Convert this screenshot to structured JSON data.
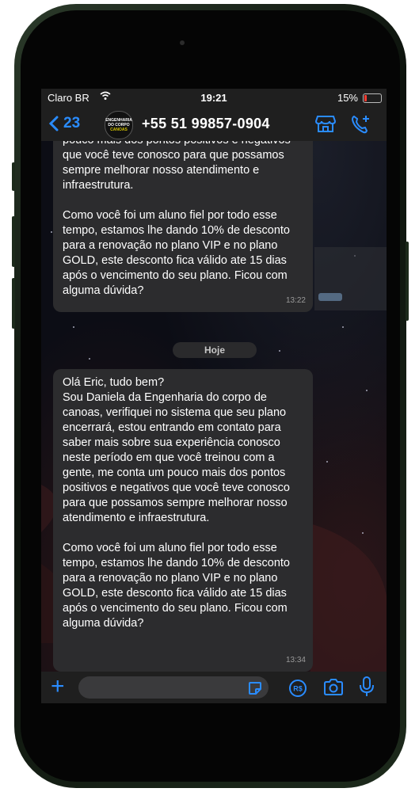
{
  "status_bar": {
    "carrier": "Claro BR",
    "time": "19:21",
    "battery": "15%",
    "battery_level": 0.15
  },
  "header": {
    "back_count": "23",
    "avatar_text": [
      "ENGENHARIA",
      "DO CORPO",
      "CANOAS"
    ],
    "contact": "+55 51 99857-0904",
    "icons": [
      "storefront-icon",
      "phone-add-icon"
    ]
  },
  "messages": [
    {
      "paragraphs": [
        "pouco mais dos pontos positivos e negativos que você teve conosco para que possamos sempre melhorar nosso atendimento e infraestrutura.",
        "Como você foi um aluno fiel por todo esse tempo, estamos lhe dando 10% de desconto para a renovação no plano VIP e no plano GOLD, este desconto fica válido ate 15 dias após o vencimento do seu plano. Ficou com alguma dúvida?"
      ],
      "time": "13:22"
    },
    {
      "paragraphs": [
        "Olá Eric, tudo bem?\nSou Daniela da Engenharia do corpo de canoas, verifiquei no sistema que seu plano encerrará, estou entrando em contato para saber mais sobre sua experiência conosco neste período em que você treinou com a gente, me conta um pouco mais dos pontos positivos e negativos que você teve conosco para que possamos sempre melhorar nosso atendimento e infraestrutura.",
        "Como você foi um aluno fiel por todo esse tempo, estamos lhe dando 10% de desconto para a renovação no plano VIP e no plano GOLD, este desconto fica válido ate 15 dias após o vencimento do seu plano. Ficou com alguma dúvida?"
      ],
      "time": "13:34"
    }
  ],
  "day_divider": "Hoje",
  "input_bar": {
    "placeholder": "",
    "icons": [
      "plus-icon",
      "sticker-icon",
      "payment-icon",
      "camera-icon",
      "microphone-icon"
    ]
  },
  "colors": {
    "accent": "#2a8cff",
    "bubble": "#2c2c2e",
    "bar": "#1f1f1f"
  }
}
